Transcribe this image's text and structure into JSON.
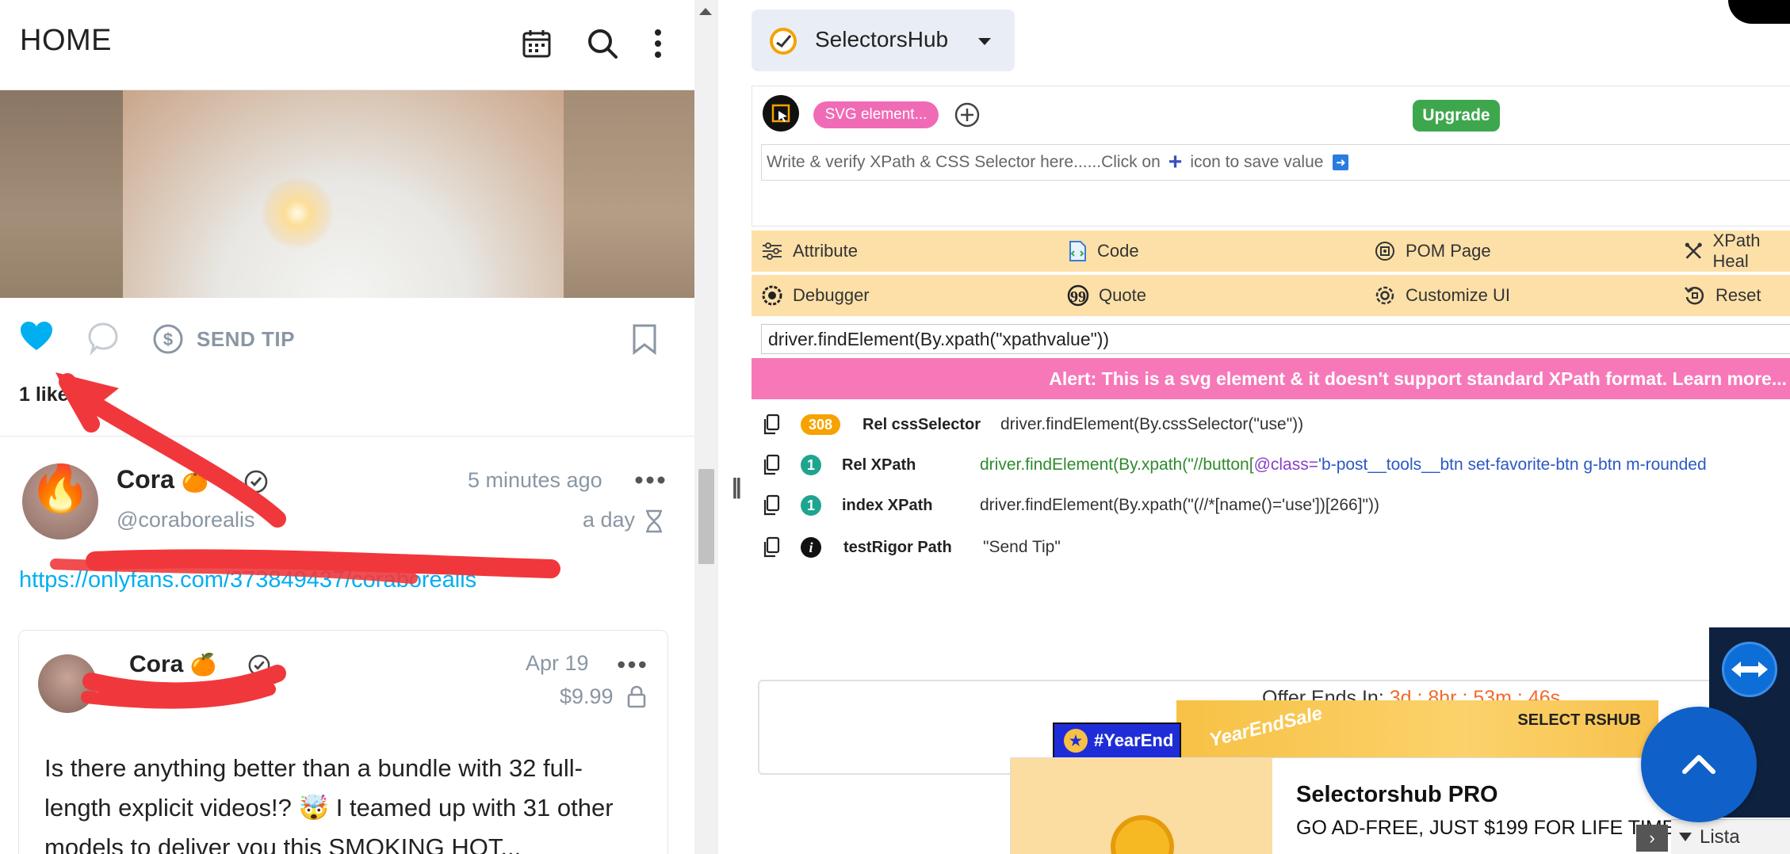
{
  "feed": {
    "header": {
      "title": "HOME"
    },
    "post": {
      "send_tip_label": "SEND TIP",
      "likes_text": "1 like"
    },
    "comment": {
      "name": "Cora",
      "name_emoji": "🍊",
      "handle": "@coraborealis",
      "time": "5 minutes ago",
      "subtime": "a day",
      "link": "https://onlyfans.com/373849437/coraborealis"
    },
    "card": {
      "name": "Cora",
      "name_emoji": "🍊",
      "date": "Apr 19",
      "price": "$9.99",
      "text": "Is there anything better than a bundle with 32 full-length explicit videos!? 🤯 I teamed up with 31 other models to deliver you this SMOKING HOT..."
    }
  },
  "selectorshub": {
    "dropdown_label": "SelectorsHub",
    "svg_pill": "SVG element...",
    "upgrade_label": "Upgrade",
    "input_placeholder_pre": "Write & verify XPath & CSS Selector here......Click on",
    "input_placeholder_post": "icon to save value",
    "toolbar_row1": [
      "Attribute",
      "Code",
      "POM Page",
      "XPath Heal"
    ],
    "toolbar_row2": [
      "Debugger",
      "Quote",
      "Customize UI",
      "Reset"
    ],
    "code_line": "driver.findElement(By.xpath(\"xpathvalue\"))",
    "alert": "Alert: This is a svg element & it doesn't support standard XPath format. Learn more...",
    "rows": [
      {
        "count": "308",
        "label": "Rel cssSelector",
        "value": "driver.findElement(By.cssSelector(\"use\"))"
      },
      {
        "count": "1",
        "label": "Rel XPath",
        "value_prefix": "driver.findElement(By.xpath(\"//button[",
        "value_attr": "@class=",
        "value_str": "'b-post__tools__btn set-favorite-btn g-btn m-rounded"
      },
      {
        "count": "1",
        "label": "index XPath",
        "value": "driver.findElement(By.xpath(\"(//*[name()='use'])[266]\"))"
      },
      {
        "count": "i",
        "label": "testRigor Path",
        "value": "\"Send Tip\""
      }
    ],
    "offer_label": "Offer Ends In: ",
    "offer_countdown": "3d : 8hr : 53m : 46s",
    "banner_brand": "SELECT RSHUB",
    "banner_sale": "YearEndSale",
    "banner_tag": "#YearEnd",
    "promo_title": "Selectorshub PRO",
    "promo_sub": "GO AD-FREE, JUST $199 FOR LIFE TIME"
  },
  "taskbar": {
    "lista_label": "Lista"
  },
  "colors": {
    "accent_blue": "#00aff0",
    "toolbar_bg": "#fde0a8",
    "alert_bg": "#f778b9",
    "upgrade_green": "#3ea74d",
    "fab_blue": "#0f60c9"
  }
}
